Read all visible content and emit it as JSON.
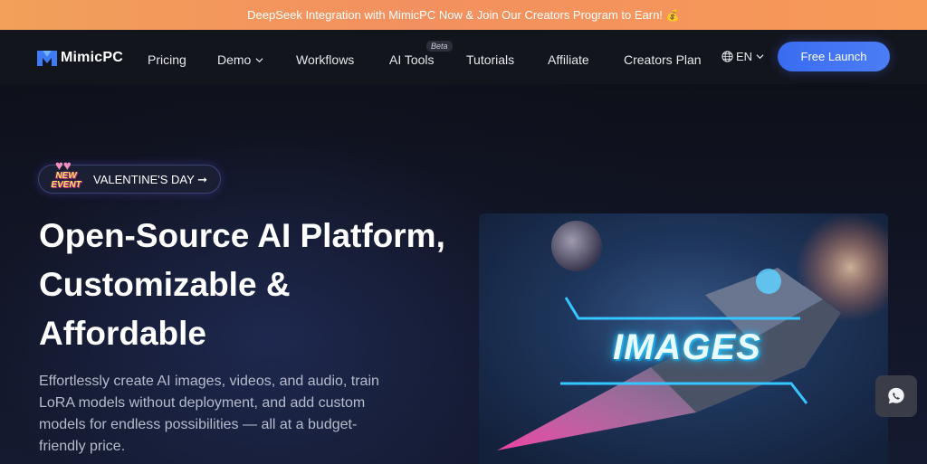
{
  "announcement": {
    "text": "DeepSeek Integration with MimicPC Now & Join Our Creators Program to Earn!",
    "emoji": "💰"
  },
  "nav": {
    "brand": "MimicPC",
    "items": [
      {
        "label": "Pricing"
      },
      {
        "label": "Demo",
        "has_dropdown": true
      },
      {
        "label": "Workflows"
      },
      {
        "label": "AI Tools",
        "badge": "Beta"
      },
      {
        "label": "Tutorials"
      },
      {
        "label": "Affiliate"
      },
      {
        "label": "Creators Plan"
      }
    ],
    "language": "EN",
    "cta": "Free Launch"
  },
  "hero": {
    "event_badge": "NEW EVENT",
    "event_label": "VALENTINE'S DAY ➞",
    "title": "Open-Source AI Platform, Customizable & Affordable",
    "subtitle": "Effortlessly create AI images, videos, and audio, train LoRA models without deployment, and add custom models for endless possibilities — all at a budget-friendly price.",
    "showcase_label": "IMAGES"
  },
  "colors": {
    "announce_bg": "#f3905f",
    "nav_bg": "#13151d",
    "cta_bg": "#4074f3",
    "hero_bg": "#0e1019",
    "subtitle": "#b6bccb"
  },
  "icons": {
    "logo": "mimicpc-logo-icon",
    "globe": "globe-icon",
    "chevron": "chevron-down-icon",
    "chat": "chat-bubble-icon"
  }
}
